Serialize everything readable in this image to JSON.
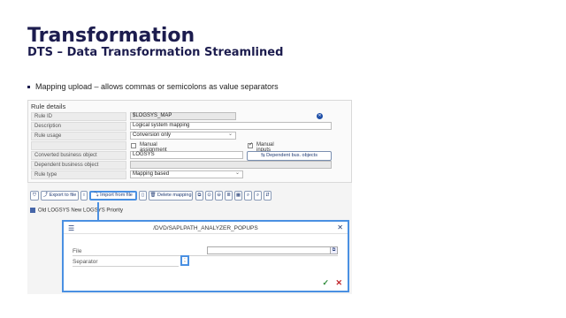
{
  "slide": {
    "title": "Transformation",
    "subtitle": "DTS – Data Transformation Streamlined",
    "bullet": "Mapping upload – allows commas or semicolons as value separators"
  },
  "rule_details": {
    "title": "Rule details",
    "rows": [
      {
        "label": "Rule ID",
        "value": "$LOGSYS_MAP"
      },
      {
        "label": "Description",
        "value": "Logical system mapping"
      },
      {
        "label": "Rule usage",
        "value": "Conversion only"
      },
      {
        "label": "",
        "value": ""
      },
      {
        "label": "Converted business object",
        "value": "LOGSYS"
      },
      {
        "label": "Dependent business object",
        "value": ""
      },
      {
        "label": "Rule type",
        "value": "Mapping based"
      }
    ],
    "manual_assignment_label": "Manual assignment",
    "manual_inputs_label": "Manual inputs required",
    "dependent_button": "Dependent bus. objects"
  },
  "toolbar": {
    "export_label": "Export to file",
    "import_label": "Import from file",
    "delete_label": "Delete mapping"
  },
  "table": {
    "header": "Old LOGSYS  New LOGSYS  Priority"
  },
  "dialog": {
    "title": "/DVD/SAPLPATH_ANALYZER_POPUPS",
    "file_label": "File",
    "separator_label": "Separator",
    "separator_value": ";",
    "file_value": ""
  },
  "icons": {
    "menu": "hamburger-icon",
    "close": "close-icon",
    "ok": "check-icon",
    "cancel": "cancel-icon"
  }
}
